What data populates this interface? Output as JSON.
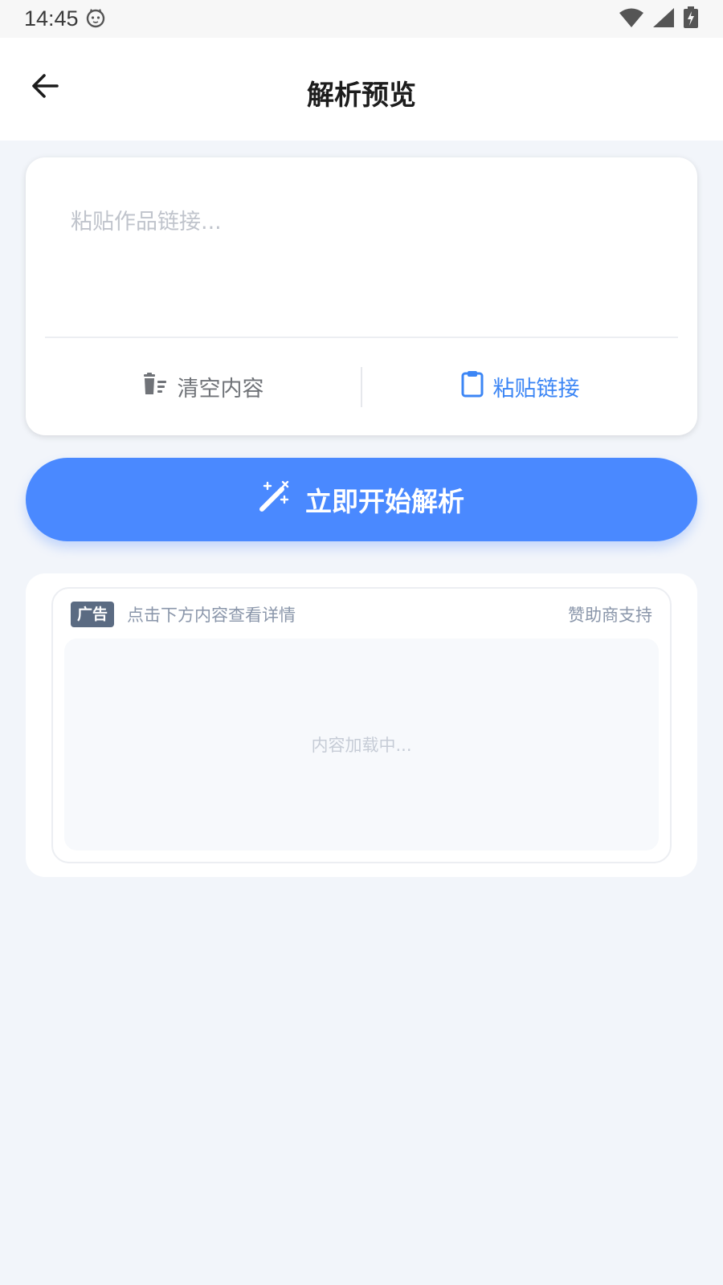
{
  "status_bar": {
    "time": "14:45",
    "icons": [
      "cat-face-icon",
      "wifi-icon",
      "signal-icon",
      "battery-charging-icon"
    ]
  },
  "app_bar": {
    "title": "解析预览",
    "back_icon": "arrow-left-icon"
  },
  "input_card": {
    "placeholder": "粘贴作品链接...",
    "value": "",
    "clear_label": "清空内容",
    "clear_icon": "clear-list-icon",
    "paste_label": "粘贴链接",
    "paste_icon": "clipboard-icon"
  },
  "primary_action": {
    "label": "立即开始解析",
    "icon": "magic-wand-icon"
  },
  "ad": {
    "badge": "广告",
    "hint": "点击下方内容查看详情",
    "sponsor": "赞助商支持",
    "loading": "内容加载中..."
  },
  "colors": {
    "accent": "#4a89ff",
    "paste_text": "#3c86f5",
    "page_bg": "#f2f5fa",
    "badge_bg": "#5b6b82"
  }
}
